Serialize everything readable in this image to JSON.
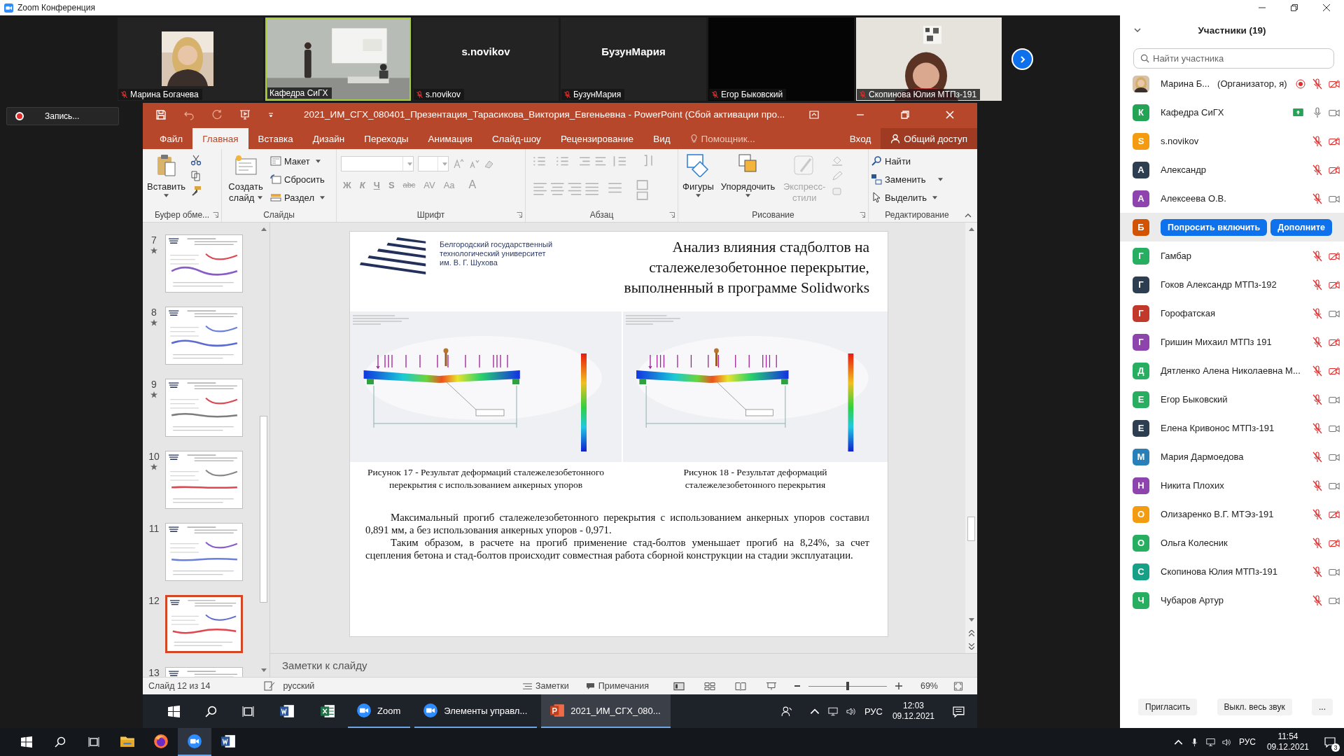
{
  "zoom_window": {
    "title": "Zoom Конференция"
  },
  "video_tiles": [
    {
      "kind": "camera",
      "label": "Марина Богачева",
      "muted": true,
      "selected": false
    },
    {
      "kind": "camera",
      "label": "Кафедра СиГХ",
      "muted": false,
      "selected": true
    },
    {
      "kind": "name",
      "display_name": "s.novikov",
      "label": "s.novikov",
      "muted": true,
      "selected": false
    },
    {
      "kind": "name",
      "display_name": "БузунМария",
      "label": "БузунМария",
      "muted": true,
      "selected": false
    },
    {
      "kind": "blank",
      "label": "Егор Быковский",
      "muted": true,
      "selected": false
    },
    {
      "kind": "camera",
      "label": "Скопинова Юлия МТПз-191",
      "muted": true,
      "selected": false
    }
  ],
  "recording": {
    "label": "Запись..."
  },
  "powerpoint": {
    "title": "2021_ИМ_СГХ_080401_Презентация_Тарасикова_Виктория_Евгеньевна - PowerPoint (Сбой активации про...",
    "tabs": [
      {
        "label": "Файл",
        "selected": false
      },
      {
        "label": "Главная",
        "selected": true
      },
      {
        "label": "Вставка",
        "selected": false
      },
      {
        "label": "Дизайн",
        "selected": false
      },
      {
        "label": "Переходы",
        "selected": false
      },
      {
        "label": "Анимация",
        "selected": false
      },
      {
        "label": "Слайд-шоу",
        "selected": false
      },
      {
        "label": "Рецензирование",
        "selected": false
      },
      {
        "label": "Вид",
        "selected": false
      }
    ],
    "tell_me": "Помощник...",
    "sign_in": "Вход",
    "share": "Общий доступ",
    "ribbon": {
      "clipboard": {
        "label": "Буфер обме...",
        "paste": "Вставить"
      },
      "slides": {
        "label": "Слайды",
        "new_slide": "Создать слайд",
        "layout": "Макет",
        "reset": "Сбросить",
        "section": "Раздел"
      },
      "font": {
        "label": "Шрифт",
        "disabled": true,
        "buttons": [
          "Ж",
          "К",
          "Ч",
          "S",
          "abc",
          "AV",
          "Aa",
          "A"
        ]
      },
      "paragraph": {
        "label": "Абзац",
        "disabled": true
      },
      "drawing": {
        "label": "Рисование",
        "shapes": "Фигуры",
        "arrange": "Упорядочить",
        "styles": {
          "label": "Экспресс-стили",
          "disabled": true
        }
      },
      "editing": {
        "label": "Редактирование",
        "find": "Найти",
        "replace": "Заменить",
        "select": "Выделить"
      }
    },
    "thumbnails": [
      {
        "number": "7",
        "animated": true,
        "selected": false
      },
      {
        "number": "8",
        "animated": true,
        "selected": false
      },
      {
        "number": "9",
        "animated": true,
        "selected": false
      },
      {
        "number": "10",
        "animated": true,
        "selected": false
      },
      {
        "number": "11",
        "animated": false,
        "selected": false
      },
      {
        "number": "12",
        "animated": false,
        "selected": true
      },
      {
        "number": "13",
        "animated": false,
        "selected": false
      }
    ],
    "slide": {
      "university": [
        "Белгородский государственный",
        "технологический университет",
        "им. В. Г. Шухова"
      ],
      "title": [
        "Анализ влияния стадболтов на",
        "сталежелезобетонное перекрытие,",
        "выполненный в программе Solidworks"
      ],
      "figures": [
        {
          "kind": "picture",
          "caption": "Рисунок 17 - Результат деформаций сталежелезобетонного перекрытия с использованием анкерных упоров"
        },
        {
          "kind": "picture",
          "caption": "Рисунок 18 - Результат деформаций сталежелезобетонного перекрытия"
        }
      ],
      "paragraphs": [
        "Максимальный прогиб сталежелезобетонного перекрытия с использованием анкерных упоров составил 0,891 мм, а без использования анкерных упоров - 0,971.",
        "Таким образом, в расчете на прогиб применение стад-болтов уменьшает прогиб на 8,24%, за счет сцепления бетона и стад-болтов происходит совместная работа сборной конструкции на стадии эксплуатации."
      ]
    },
    "notes_placeholder": "Заметки к слайду",
    "status_bar": {
      "slide": "Слайд 12 из 14",
      "language": "русский",
      "notes": "Заметки",
      "comments": "Примечания",
      "zoom_slider": {
        "level": 0.5
      },
      "zoom": "69%"
    }
  },
  "shared_taskbar": {
    "apps": [
      {
        "kind": "word",
        "selected": false
      },
      {
        "kind": "excel",
        "selected": false
      },
      {
        "kind": "zoom",
        "label": "Zoom",
        "selected": false
      },
      {
        "kind": "zoom",
        "label": "Элементы управл...",
        "selected": false
      },
      {
        "kind": "powerpoint",
        "label": "2021_ИМ_СГХ_080...",
        "selected": true
      }
    ],
    "language": "РУС",
    "time": "12:03",
    "date": "09.12.2021"
  },
  "participants": {
    "title": "Участники (19)",
    "search_placeholder": "Найти участника",
    "rows": [
      {
        "name": "Марина Б...",
        "role": "(Организатор, я)",
        "recording": true,
        "sharing": false,
        "muted": true,
        "video_on": false,
        "selected": false
      },
      {
        "kind": "letter",
        "initial": "К",
        "color": "#23a455",
        "name": "Кафедра СиГХ",
        "recording": false,
        "sharing": true,
        "muted": false,
        "video_on": true,
        "selected": false
      },
      {
        "kind": "letter",
        "initial": "S",
        "color": "#f39c12",
        "name": "s.novikov",
        "recording": false,
        "sharing": false,
        "muted": true,
        "video_on": false,
        "selected": false
      },
      {
        "kind": "letter",
        "initial": "А",
        "color": "#2c3e50",
        "name": "Александр",
        "recording": false,
        "sharing": false,
        "muted": true,
        "video_on": false,
        "selected": false
      },
      {
        "kind": "letter",
        "initial": "А",
        "color": "#8e44ad",
        "name": "Алексеева О.В.",
        "recording": false,
        "sharing": false,
        "muted": true,
        "video_on": true,
        "selected": false
      },
      {
        "kind": "letter",
        "initial": "Б",
        "color": "#d35400",
        "selected": true,
        "actions": [
          "Попросить включить",
          "Дополните"
        ]
      },
      {
        "kind": "letter",
        "initial": "Г",
        "color": "#27ae60",
        "name": "Гамбар",
        "recording": false,
        "sharing": false,
        "muted": true,
        "video_on": false,
        "selected": false
      },
      {
        "kind": "letter",
        "initial": "Г",
        "color": "#2c3e50",
        "name": "Гоков Александр МТПз-192",
        "recording": false,
        "sharing": false,
        "muted": true,
        "video_on": false,
        "selected": false
      },
      {
        "kind": "letter",
        "initial": "Г",
        "color": "#c0392b",
        "name": "Горофатская",
        "recording": false,
        "sharing": false,
        "muted": true,
        "video_on": true,
        "selected": false
      },
      {
        "kind": "letter",
        "initial": "Г",
        "color": "#8e44ad",
        "name": "Гришин Михаил МТПз 191",
        "recording": false,
        "sharing": false,
        "muted": true,
        "video_on": false,
        "selected": false
      },
      {
        "kind": "letter",
        "initial": "Д",
        "color": "#27ae60",
        "name": "Дятленко Алена Николаевна М...",
        "recording": false,
        "sharing": false,
        "muted": true,
        "video_on": false,
        "selected": false
      },
      {
        "kind": "letter",
        "initial": "Е",
        "color": "#27ae60",
        "name": "Егор Быковский",
        "recording": false,
        "sharing": false,
        "muted": true,
        "video_on": true,
        "selected": false
      },
      {
        "kind": "letter",
        "initial": "Е",
        "color": "#2c3e50",
        "name": "Елена Кривонос МТПз-191",
        "recording": false,
        "sharing": false,
        "muted": true,
        "video_on": true,
        "selected": false
      },
      {
        "kind": "letter",
        "initial": "М",
        "color": "#2980b9",
        "name": "Мария Дармоедова",
        "recording": false,
        "sharing": false,
        "muted": true,
        "video_on": true,
        "selected": false
      },
      {
        "kind": "letter",
        "initial": "Н",
        "color": "#8e44ad",
        "name": "Никита Плохих",
        "recording": false,
        "sharing": false,
        "muted": true,
        "video_on": true,
        "selected": false
      },
      {
        "kind": "letter",
        "initial": "О",
        "color": "#f39c12",
        "name": "Олизаренко В.Г. МТЭз-191",
        "recording": false,
        "sharing": false,
        "muted": true,
        "video_on": false,
        "selected": false
      },
      {
        "kind": "letter",
        "initial": "О",
        "color": "#27ae60",
        "name": "Ольга Колесник",
        "recording": false,
        "sharing": false,
        "muted": true,
        "video_on": false,
        "selected": false
      },
      {
        "kind": "letter",
        "initial": "С",
        "color": "#16a085",
        "name": "Скопинова Юлия МТПз-191",
        "recording": false,
        "sharing": false,
        "muted": true,
        "video_on": true,
        "selected": false
      },
      {
        "kind": "letter",
        "initial": "Ч",
        "color": "#27ae60",
        "name": "Чубаров Артур",
        "recording": false,
        "sharing": false,
        "muted": true,
        "video_on": true,
        "selected": false
      }
    ],
    "footer": [
      "Пригласить",
      "Выкл. весь звук",
      "..."
    ]
  },
  "taskbar": {
    "apps": [
      {
        "kind": "explorer",
        "selected": false
      },
      {
        "kind": "firefox",
        "selected": false
      },
      {
        "kind": "zoom",
        "selected": true
      },
      {
        "kind": "word",
        "selected": false
      }
    ],
    "language": "РУС",
    "time": "11:54",
    "date": "09.12.2021",
    "notifications": "3"
  }
}
